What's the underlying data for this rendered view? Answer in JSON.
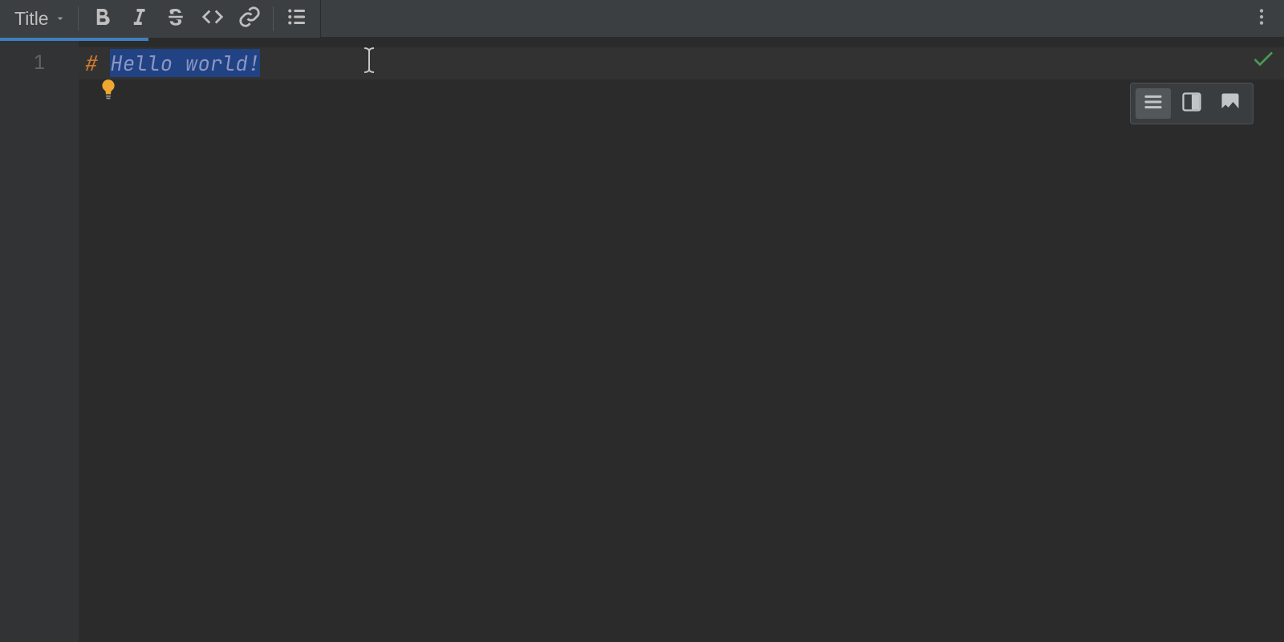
{
  "toolbar": {
    "style_dropdown_label": "Title",
    "buttons": {
      "bold_title": "Bold",
      "italic_title": "Italic",
      "strike_title": "Strikethrough",
      "code_title": "Code",
      "link_title": "Link",
      "list_title": "Bullet List",
      "more_title": "More"
    }
  },
  "editor": {
    "line_numbers": [
      "1"
    ],
    "line1_hash": "# ",
    "line1_text": "Hello world!",
    "caret_after": true
  },
  "status": {
    "ok_title": "No problems"
  },
  "intentions": {
    "bulb_title": "Show intention actions"
  },
  "view_switcher": {
    "editor_title": "Editor only",
    "split_title": "Editor and Preview",
    "preview_title": "Preview only",
    "active": "editor"
  },
  "colors": {
    "selection": "#214283",
    "keyword": "#cc7832",
    "ok": "#499c54",
    "accent": "#3f7fbf"
  }
}
